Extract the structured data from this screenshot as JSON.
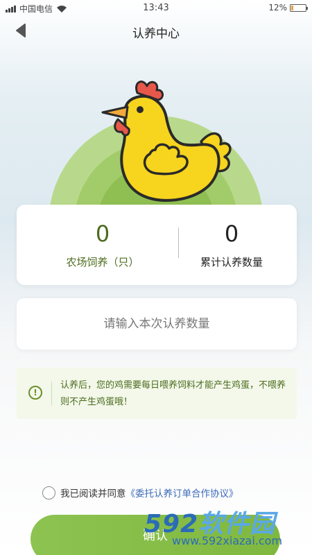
{
  "status_bar": {
    "carrier": "中国电信",
    "time": "13:43",
    "battery_percent": "12%"
  },
  "nav": {
    "title": "认养中心",
    "back_icon": "chevron-left-icon"
  },
  "hero": {
    "image": "cartoon-hen-icon",
    "colors": {
      "outer_circle": "#b8d98b",
      "mid_circle": "#9cc85f",
      "inner_circle": "#86b648",
      "hen_body": "#f7d41d",
      "hen_comb": "#e8584a"
    }
  },
  "stats": {
    "farm_count": {
      "value": "0",
      "label": "农场饲养（只）"
    },
    "total_adopted": {
      "value": "0",
      "label": "累计认养数量"
    }
  },
  "adopt_input": {
    "value": "",
    "placeholder": "请输入本次认养数量"
  },
  "notice": {
    "icon": "exclamation-circle-icon",
    "text": "认养后，您的鸡需要每日喂养饲料才能产生鸡蛋，不喂养则不产生鸡蛋哦！"
  },
  "agreement": {
    "checked": false,
    "text": "我已阅读并同意",
    "link": "《委托认养订单合作协议》"
  },
  "confirm_button": {
    "label": "确认"
  },
  "watermark": {
    "logo_digits": "592",
    "logo_text": "软件园",
    "site": "www.592xiazai.com"
  },
  "colors": {
    "accent_green": "#4c6b1d",
    "button_green": "#8dc351",
    "link_blue": "#3b6bb8"
  }
}
